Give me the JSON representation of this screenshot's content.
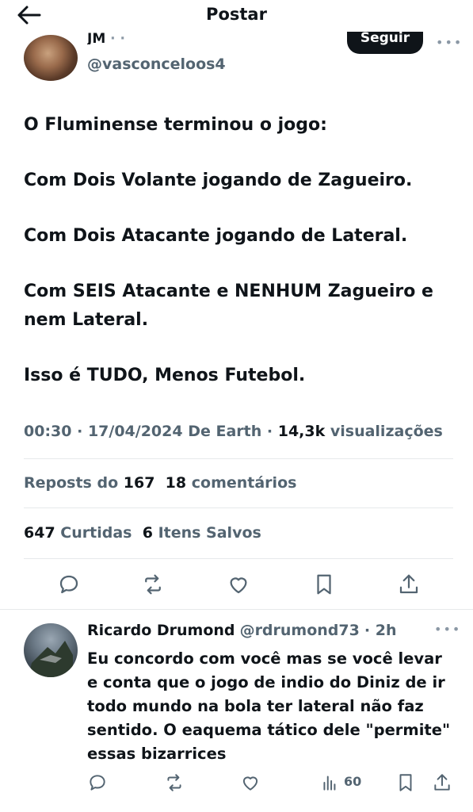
{
  "header": {
    "title": "Postar",
    "back_icon": "arrow-left-icon"
  },
  "author": {
    "name": "JM",
    "name_suffix": "· ·",
    "handle": "@vasconceloos4",
    "follow_label": "Seguir",
    "more_icon": "more-horizontal-icon"
  },
  "tweet": {
    "lines": [
      "O Fluminense terminou o jogo:",
      "Com Dois Volante jogando de Zagueiro.",
      "Com Dois Atacante jogando de Lateral.",
      "Com SEIS Atacante e NENHUM Zagueiro e nem Lateral.",
      "Isso é TUDO, Menos Futebol."
    ]
  },
  "meta": {
    "time": "00:30",
    "date": "17/04/2024",
    "source": "De Earth",
    "views": "14,3k",
    "views_label": "visualizações"
  },
  "stats": {
    "reposts_label": "Reposts do",
    "reposts": "167",
    "comments": "18",
    "comments_label": "comentários",
    "likes": "647",
    "likes_label": "Curtidas",
    "saves": "6",
    "saves_label": "Itens Salvos"
  },
  "actions": [
    "reply-icon",
    "repost-icon",
    "like-icon",
    "bookmark-icon",
    "share-icon"
  ],
  "reply": {
    "name": "Ricardo Drumond",
    "handle": "@rdrumond73",
    "time": "· 2h",
    "text": "Eu concordo com você mas se você levar e conta que o jogo de indio do Diniz de ir todo mundo na bola ter lateral não faz sentido. O eaquema tático dele \"permite\" essas bizarrices",
    "views": "60"
  },
  "colors": {
    "text": "#0f1419",
    "secondary": "#536471",
    "divider": "#e6e9eb",
    "button_bg": "#0f1419"
  }
}
